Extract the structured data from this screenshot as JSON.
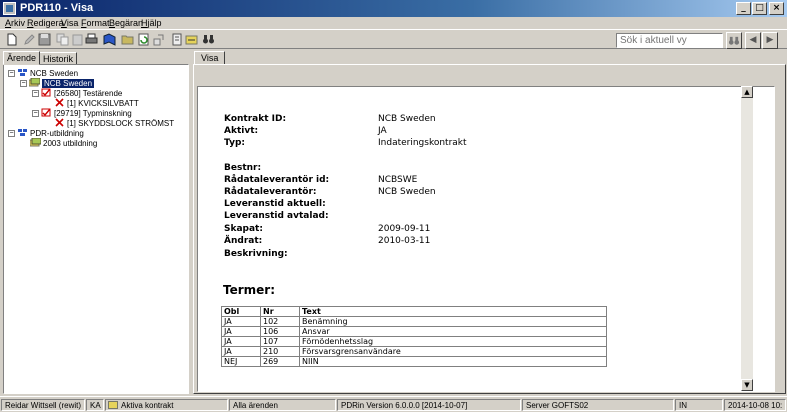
{
  "window": {
    "title": "PDR110 - Visa",
    "controls": [
      "_",
      "□",
      "×"
    ]
  },
  "menu": [
    "Arkiv",
    "Redigera",
    "Visa",
    "Format",
    "Begäran",
    "Hjälp"
  ],
  "search": {
    "placeholder": "Sök i aktuell vy"
  },
  "left_tabs": [
    "Ärende",
    "Historik"
  ],
  "tree": [
    {
      "label": "NCB Sweden",
      "level": 0
    },
    {
      "label": "NCB Sweden",
      "level": 1,
      "selected": true
    },
    {
      "label": "[26580] Testärende",
      "level": 2
    },
    {
      "label": "[1] KVICKSILVBATT",
      "level": 3
    },
    {
      "label": "[29719] Typminskning",
      "level": 2
    },
    {
      "label": "[1] SKYDDSLOCK STRÖMST",
      "level": 3
    },
    {
      "label": "PDR-utbildning",
      "level": 0
    },
    {
      "label": "2003 utbildning",
      "level": 1
    }
  ],
  "main_tab": "Visa",
  "details": [
    {
      "label": "Kontrakt ID:",
      "value": "NCB Sweden"
    },
    {
      "label": "Aktivt:",
      "value": "JA"
    },
    {
      "label": "Typ:",
      "value": "Indateringskontrakt"
    },
    {
      "label": "Bestnr:",
      "value": ""
    },
    {
      "label": "Rådataleverantör id:",
      "value": "NCBSWE"
    },
    {
      "label": "Rådataleverantör:",
      "value": "NCB Sweden"
    },
    {
      "label": "Leveranstid aktuell:",
      "value": ""
    },
    {
      "label": "Leveranstid avtalad:",
      "value": ""
    },
    {
      "label": "Skapat:",
      "value": "2009-09-11"
    },
    {
      "label": "Ändrat:",
      "value": "2010-03-11"
    },
    {
      "label": "Beskrivning:",
      "value": ""
    }
  ],
  "terms": {
    "heading": "Termer:",
    "columns": [
      "Obl",
      "Nr",
      "Text"
    ],
    "rows": [
      [
        "JA",
        "102",
        "Benämning"
      ],
      [
        "JA",
        "106",
        "Ansvar"
      ],
      [
        "JA",
        "107",
        "Förnödenhetsslag"
      ],
      [
        "JA",
        "210",
        "Försvarsgrensanvändare"
      ],
      [
        "NEJ",
        "269",
        "NIIN"
      ]
    ]
  },
  "status": {
    "user": "Reidar Wittsell (rewit)",
    "role": "KA",
    "contracts": "Aktiva kontrakt",
    "cases": "Alla ärenden",
    "version": "PDRin Version 6.0.0.0 [2014-10-07]",
    "server": "Server GOFTS02",
    "mode": "IN",
    "datetime": "2014-10-08 10:"
  }
}
